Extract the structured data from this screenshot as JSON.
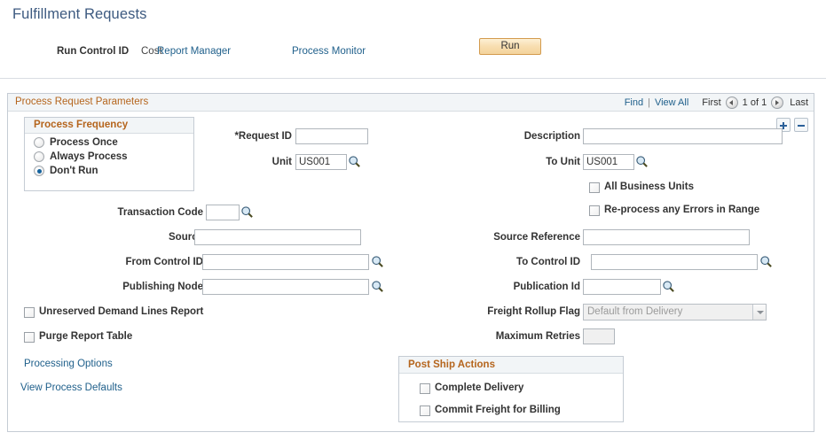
{
  "page": {
    "title": "Fulfillment Requests"
  },
  "run_control": {
    "label": "Run Control ID",
    "value": "Cost",
    "report_manager_link": "Report Manager",
    "process_monitor_link": "Process Monitor",
    "run_button": "Run"
  },
  "panel": {
    "header": "Process Request Parameters",
    "nav": {
      "find": "Find",
      "separator": "|",
      "view_all": "View All",
      "first": "First",
      "counter": "1 of 1",
      "last": "Last",
      "prev_icon": "circle-left-arrow-icon",
      "next_icon": "circle-right-arrow-icon"
    },
    "row_actions": {
      "add": "+",
      "delete": "-"
    }
  },
  "process_frequency": {
    "title": "Process Frequency",
    "options": [
      {
        "label": "Process Once",
        "selected": false
      },
      {
        "label": "Always Process",
        "selected": false
      },
      {
        "label": "Don't Run",
        "selected": true
      }
    ]
  },
  "fields": {
    "request_id": {
      "label": "Request ID",
      "required": true,
      "value": "",
      "placeholder": ""
    },
    "unit": {
      "label": "Unit",
      "value": "US001",
      "lookup_icon": "magnifier-icon"
    },
    "description": {
      "label": "Description",
      "value": "",
      "placeholder": ""
    },
    "to_unit": {
      "label": "To Unit",
      "value": "US001",
      "lookup_icon": "magnifier-icon"
    },
    "all_business_units": {
      "label": "All Business Units",
      "checked": false
    },
    "reprocess_errors": {
      "label": "Re-process any Errors in Range",
      "checked": false
    },
    "transaction_code": {
      "label": "Transaction Code",
      "value": "",
      "lookup_icon": "magnifier-icon"
    },
    "source": {
      "label": "Source",
      "value": ""
    },
    "source_reference": {
      "label": "Source Reference",
      "value": ""
    },
    "from_control_id": {
      "label": "From Control ID",
      "value": "",
      "lookup_icon": "magnifier-icon"
    },
    "to_control_id": {
      "label": "To Control ID",
      "value": "",
      "lookup_icon": "magnifier-icon"
    },
    "publishing_node": {
      "label": "Publishing Node",
      "value": "",
      "lookup_icon": "magnifier-icon"
    },
    "publication_id": {
      "label": "Publication Id",
      "value": "",
      "lookup_icon": "magnifier-icon"
    },
    "unreserved_demand": {
      "label": "Unreserved Demand Lines Report",
      "checked": false
    },
    "purge_report_table": {
      "label": "Purge Report Table",
      "checked": false
    },
    "freight_rollup_flag": {
      "label": "Freight Rollup Flag",
      "value": "Default from Delivery",
      "disabled": true,
      "options": [
        "Default from Delivery"
      ]
    },
    "maximum_retries": {
      "label": "Maximum Retries",
      "value": ""
    }
  },
  "links": {
    "processing_options": "Processing Options",
    "view_process_defaults": "View Process Defaults"
  },
  "post_ship_actions": {
    "title": "Post Ship Actions",
    "items": [
      {
        "label": "Complete Delivery",
        "checked": false
      },
      {
        "label": "Commit Freight for Billing",
        "checked": false
      }
    ]
  },
  "colors": {
    "title_blue": "#3d5a80",
    "link_blue": "#21618c",
    "group_header_brown": "#b5651d",
    "run_button_border": "#d39b4e",
    "panel_border": "#c5ccd4"
  }
}
